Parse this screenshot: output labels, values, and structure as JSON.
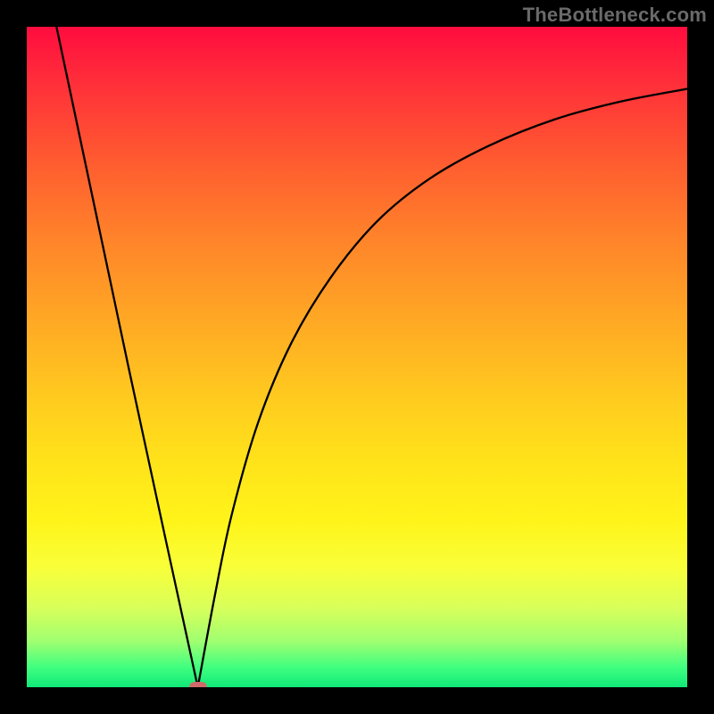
{
  "watermark": "TheBottleneck.com",
  "chart_data": {
    "type": "line",
    "title": "",
    "xlabel": "",
    "ylabel": "",
    "xlim": [
      0,
      100
    ],
    "ylim": [
      0,
      100
    ],
    "grid": false,
    "legend": false,
    "background": {
      "kind": "vertical-gradient",
      "stops": [
        {
          "pos": 0.0,
          "color": "#ff0c3e"
        },
        {
          "pos": 0.2,
          "color": "#ff5a30"
        },
        {
          "pos": 0.44,
          "color": "#ffa724"
        },
        {
          "pos": 0.66,
          "color": "#ffe31a"
        },
        {
          "pos": 0.82,
          "color": "#f8ff3a"
        },
        {
          "pos": 0.93,
          "color": "#a0ff70"
        },
        {
          "pos": 1.0,
          "color": "#10e878"
        }
      ]
    },
    "series": [
      {
        "name": "left-branch",
        "x": [
          4.5,
          10.0,
          15.5,
          21.0,
          25.9
        ],
        "y": [
          100.0,
          74.0,
          48.0,
          22.5,
          0.0
        ]
      },
      {
        "name": "right-branch",
        "x": [
          25.9,
          28.5,
          31.0,
          35.0,
          40.0,
          46.0,
          53.0,
          61.0,
          70.0,
          80.0,
          90.0,
          100.0
        ],
        "y": [
          0.0,
          14.0,
          26.0,
          40.0,
          52.0,
          62.0,
          70.5,
          77.0,
          82.0,
          86.0,
          88.7,
          90.6
        ]
      }
    ],
    "marker": {
      "x": 25.9,
      "y": 0.0,
      "color": "#cf6a6a",
      "shape": "rounded-rect"
    }
  }
}
